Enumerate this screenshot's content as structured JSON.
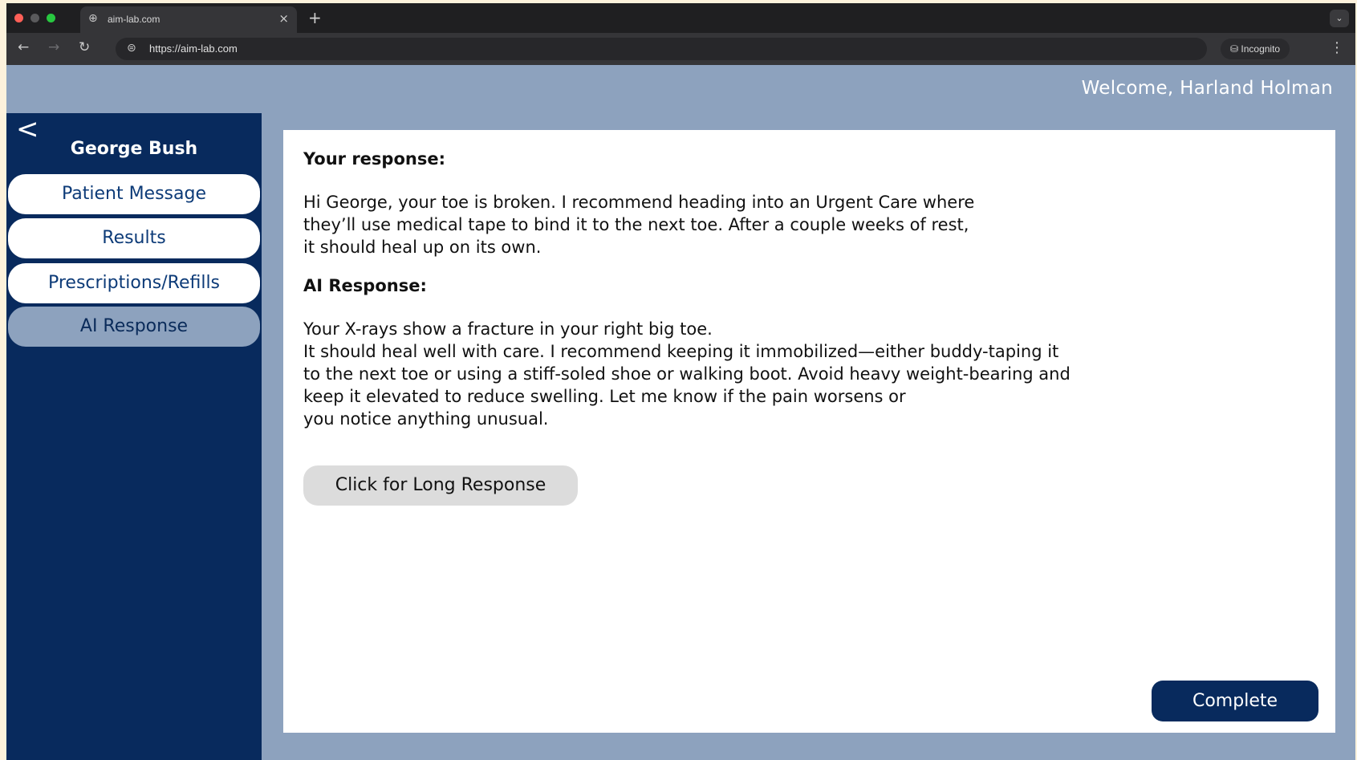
{
  "browser": {
    "tab_title": "aim-lab.com",
    "url": "https://aim-lab.com",
    "incognito_label": "Incognito"
  },
  "header": {
    "welcome": "Welcome, Harland Holman"
  },
  "sidebar": {
    "back_icon": "<",
    "patient_name": "George Bush",
    "items": [
      {
        "label": "Patient Message",
        "active": false
      },
      {
        "label": "Results",
        "active": false
      },
      {
        "label": "Prescriptions/Refills",
        "active": false
      },
      {
        "label": "AI Response",
        "active": true
      }
    ]
  },
  "main": {
    "your_response_label": "Your response:",
    "your_response_lines": [
      "Hi George, your toe is broken. I recommend heading into an Urgent Care where",
      "they’ll use medical tape to bind it to the next toe. After a couple weeks of rest,",
      "it should heal up on its own."
    ],
    "ai_response_label": "AI Response:",
    "ai_response_lines": [
      "Your X-rays show a fracture in your right big toe.",
      "It should heal well with care. I recommend keeping it immobilized—either buddy-taping it",
      "to the next toe or using a stiff-soled shoe or walking boot. Avoid heavy weight-bearing and",
      "keep it elevated to reduce swelling. Let me know if the pain worsens or",
      "you notice anything unusual."
    ],
    "long_response_button": "Click for Long Response",
    "complete_button": "Complete"
  },
  "colors": {
    "sidebar_bg": "#082a5d",
    "header_bg": "#8da2be",
    "active_item_bg": "#8da2be",
    "complete_button_bg": "#082a5d"
  }
}
